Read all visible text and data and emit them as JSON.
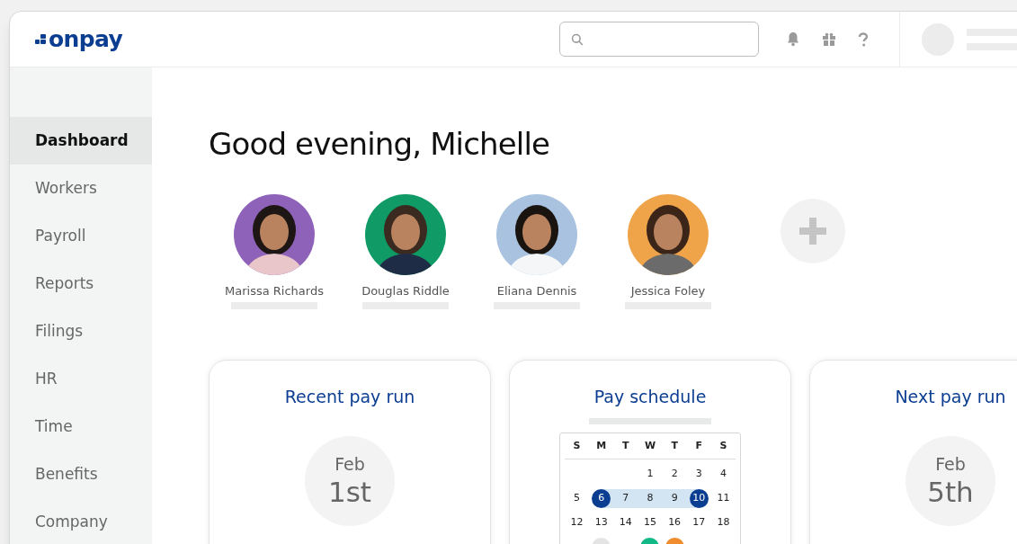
{
  "logo": "onpay",
  "sidebar": {
    "items": [
      {
        "label": "Dashboard",
        "selected": true
      },
      {
        "label": "Workers",
        "selected": false
      },
      {
        "label": "Payroll",
        "selected": false
      },
      {
        "label": "Reports",
        "selected": false
      },
      {
        "label": "Filings",
        "selected": false
      },
      {
        "label": "HR",
        "selected": false
      },
      {
        "label": "Time",
        "selected": false
      },
      {
        "label": "Benefits",
        "selected": false
      },
      {
        "label": "Company",
        "selected": false
      }
    ]
  },
  "greeting": "Good evening, Michelle",
  "team": [
    {
      "name": "Marissa Richards",
      "color": "#8e62b8"
    },
    {
      "name": "Douglas Riddle",
      "color": "#0f9a66"
    },
    {
      "name": "Eliana Dennis",
      "color": "#a9c2df"
    },
    {
      "name": "Jessica Foley",
      "color": "#f0a44a"
    }
  ],
  "cards": [
    {
      "title": "Recent pay run",
      "kind": "date",
      "month": "Feb",
      "day": "1st"
    },
    {
      "title": "Pay schedule",
      "kind": "calendar",
      "weekdays": [
        "S",
        "M",
        "T",
        "W",
        "T",
        "F",
        "S"
      ],
      "weeks": [
        [
          {
            "kind": "blank"
          },
          {
            "kind": "blank"
          },
          {
            "kind": "blank"
          },
          {
            "day": "1"
          },
          {
            "day": "2"
          },
          {
            "day": "3"
          },
          {
            "day": "4"
          }
        ],
        [
          {
            "day": "5"
          },
          {
            "day": "6",
            "kind": "endpoint"
          },
          {
            "day": "7",
            "kind": "range"
          },
          {
            "day": "8",
            "kind": "range"
          },
          {
            "day": "9",
            "kind": "range"
          },
          {
            "day": "10",
            "kind": "endpoint"
          },
          {
            "day": "11"
          }
        ],
        [
          {
            "day": "12"
          },
          {
            "day": "13"
          },
          {
            "day": "14"
          },
          {
            "day": "15"
          },
          {
            "day": "16"
          },
          {
            "day": "17"
          },
          {
            "day": "18"
          }
        ],
        [
          {
            "kind": "blank"
          },
          {
            "kind": "dot",
            "color": "#e4e4e4"
          },
          {
            "kind": "blank"
          },
          {
            "kind": "dot",
            "color": "#12b886"
          },
          {
            "kind": "dot",
            "color": "#f08c2e"
          },
          {
            "kind": "blank"
          },
          {
            "kind": "blank"
          }
        ]
      ]
    },
    {
      "title": "Next pay run",
      "kind": "date",
      "month": "Feb",
      "day": "5th"
    }
  ]
}
